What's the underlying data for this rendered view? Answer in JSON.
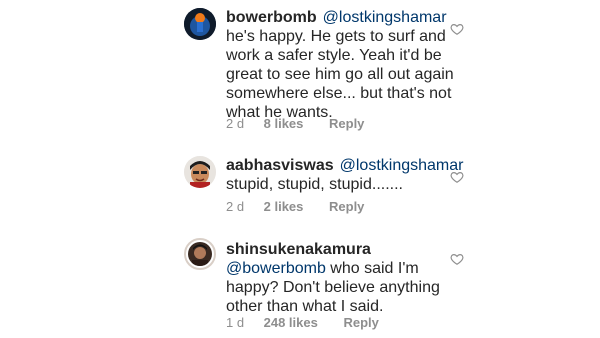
{
  "comments": [
    {
      "username": "bowerbomb",
      "mention": "@lostkingshamar",
      "text": "he's happy. He gets to surf and work a safer style. Yeah it'd be great to see him go all out again somewhere else... but that's not what he wants.",
      "time": "2 d",
      "likes": "8 likes",
      "reply": "Reply",
      "avatar_icon": "blue-orange-avatar-icon"
    },
    {
      "username": "aabhasviswas",
      "mention": "@lostkingshamar",
      "text": "stupid, stupid, stupid.......",
      "time": "2 d",
      "likes": "2 likes",
      "reply": "Reply",
      "avatar_icon": "cartoon-face-avatar-icon"
    },
    {
      "username": "shinsukenakamura",
      "mention": "@bowerbomb",
      "text": "who said I'm happy? Don't believe anything other than what I said.",
      "time": "1 d",
      "likes": "248 likes",
      "reply": "Reply",
      "avatar_icon": "portrait-avatar-icon"
    }
  ],
  "colors": {
    "text": "#262626",
    "mention": "#00376b",
    "meta": "#8e8e8e",
    "heart_outline": "#8e8e8e"
  }
}
